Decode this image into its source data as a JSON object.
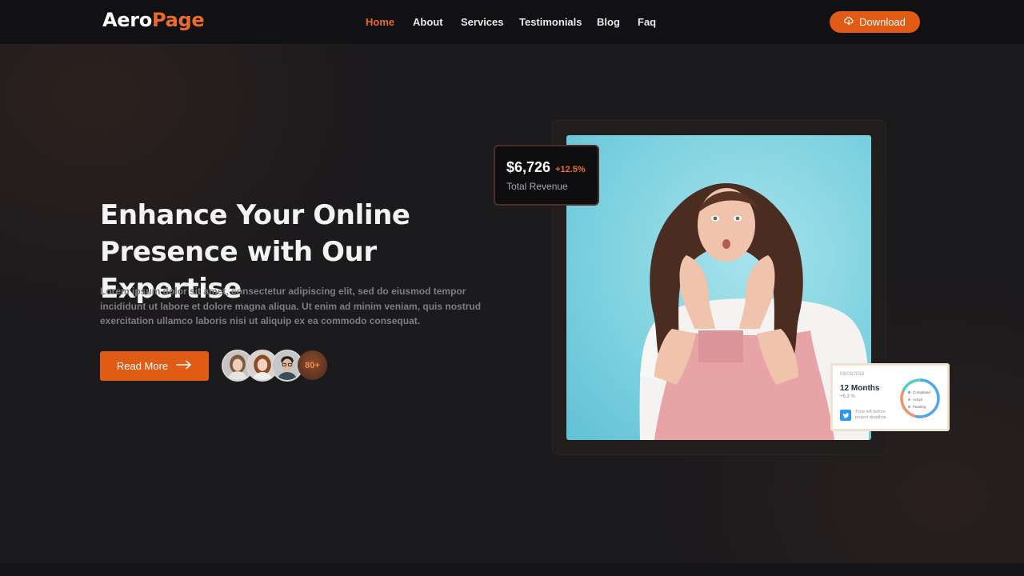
{
  "brand": {
    "logo_part1": "Aero",
    "logo_part2": "Page",
    "accent": "#ec6a2b"
  },
  "nav": {
    "items": [
      {
        "label": "Home",
        "active": true
      },
      {
        "label": "About"
      },
      {
        "label": "Services"
      },
      {
        "label": "Testimonials"
      },
      {
        "label": "Blog"
      },
      {
        "label": "Faq"
      }
    ],
    "cta_label": "Download",
    "cta_icon": "cloud-download-icon"
  },
  "hero": {
    "headline_line1": "Enhance Your Online",
    "headline_line2": "Presence with Our Expertise",
    "lede": "Lorem ipsum dolor sit amet, consectetur adipiscing elit, sed do eiusmod tempor incididunt ut labore et dolore magna aliqua. Ut enim ad minim veniam, quis nostrud exercitation ullamco laboris nisi ut aliquip ex ea commodo consequat.",
    "read_more_label": "Read More",
    "read_more_icon": "arrow-right-icon",
    "avatar_count": "80+"
  },
  "revenue_card": {
    "amount": "$6,726",
    "change": "+12.5%",
    "label": "Total Revenue"
  },
  "project_card": {
    "date": "03/03/2018",
    "title": "12 Months",
    "sub": "+6.3 %",
    "foot_text": "Time left before project deadline",
    "legend": [
      "Completed",
      "Active",
      "Pending"
    ]
  }
}
